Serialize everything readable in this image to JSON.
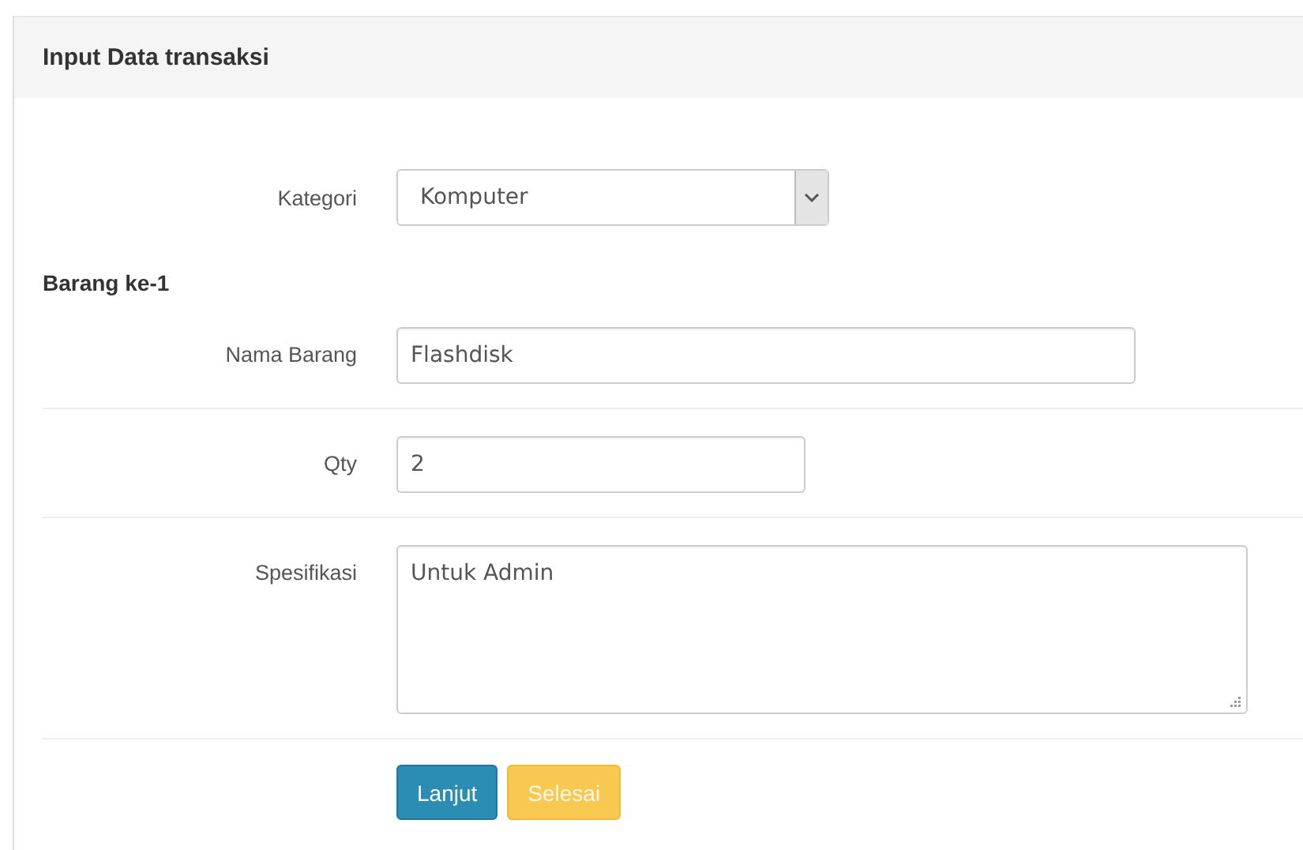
{
  "panel": {
    "title": "Input Data transaksi"
  },
  "category": {
    "label": "Kategori",
    "value": "Komputer"
  },
  "section_title": "Barang ke-1",
  "fields": [
    {
      "kind": "input",
      "label": "Nama Barang",
      "value": "Flashdisk"
    },
    {
      "kind": "input",
      "label": "Qty",
      "value": "2"
    },
    {
      "kind": "textarea",
      "label": "Spesifikasi",
      "value": "Untuk Admin"
    }
  ],
  "buttons": [
    {
      "kind": "primary",
      "label": "Lanjut"
    },
    {
      "kind": "warning",
      "label": "Selesai"
    }
  ]
}
